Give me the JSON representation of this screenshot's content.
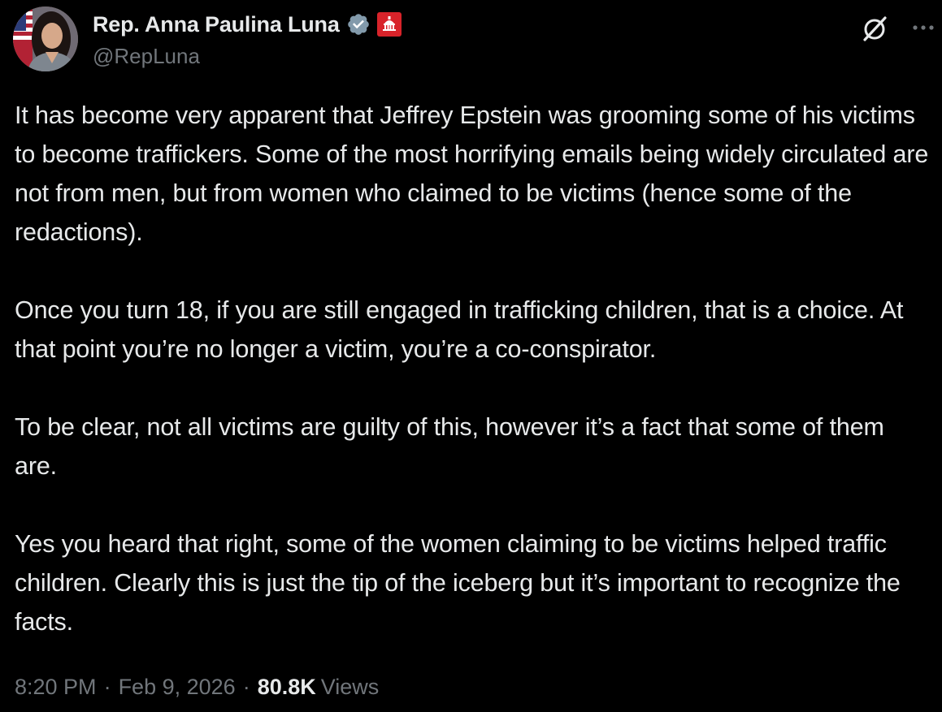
{
  "author": {
    "display_name": "Rep. Anna Paulina Luna",
    "handle": "@RepLuna",
    "avatar_icon": "profile-photo",
    "verified_icon": "verified-badge-icon",
    "verified_color": "#829aab",
    "affiliate_icon": "us-capitol-affiliate-badge",
    "affiliate_color": "#d8232a"
  },
  "actions": {
    "grok_icon": "grok-icon",
    "more_icon": "more-options-icon"
  },
  "tweet": {
    "paragraphs": [
      "It has become very apparent that Jeffrey Epstein was grooming some of his victims to become traffickers. Some of the most horrifying emails being widely circulated are not from men, but from women who claimed to be victims (hence some of the redactions).",
      "Once you turn 18, if you are still engaged in trafficking children, that is a choice. At that point you’re no longer a victim, you’re a co-conspirator.",
      "To be clear, not all victims are guilty of this, however it’s a fact that some of them are.",
      "Yes you heard that right, some of the women claiming to be victims helped traffic children. Clearly this is just the tip of the iceberg but it’s important to recognize the facts."
    ]
  },
  "meta": {
    "time": "8:20 PM",
    "separator": "·",
    "date": "Feb 9, 2026",
    "views_count": "80.8K",
    "views_label": "Views"
  },
  "colors": {
    "background": "#000000",
    "primary_text": "#e7e9ea",
    "secondary_text": "#71767b"
  }
}
